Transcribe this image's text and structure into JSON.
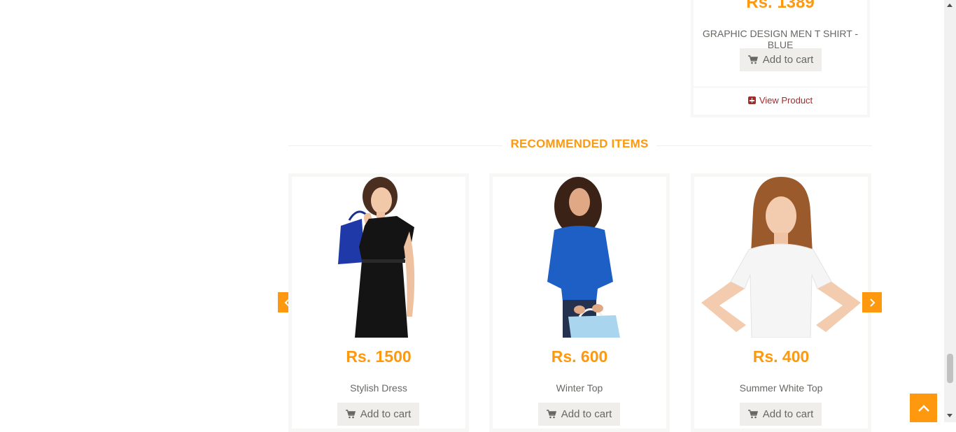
{
  "top_product": {
    "price": "Rs. 1389",
    "name": "GRAPHIC DESIGN MEN T SHIRT - BLUE",
    "add_to_cart": "Add to cart",
    "view_product": "View Product"
  },
  "recommended": {
    "title": "RECOMMENDED ITEMS",
    "items": [
      {
        "price": "Rs. 1500",
        "name": "Stylish Dress",
        "add_to_cart": "Add to cart"
      },
      {
        "price": "Rs. 600",
        "name": "Winter Top",
        "add_to_cart": "Add to cart"
      },
      {
        "price": "Rs. 400",
        "name": "Summer White Top",
        "add_to_cart": "Add to cart"
      }
    ]
  },
  "icons": {
    "cart": "shopping-cart-icon",
    "plus": "plus-square-icon",
    "prev": "chevron-left-icon",
    "next": "chevron-right-icon",
    "scroll_top": "chevron-up-icon"
  },
  "colors": {
    "accent": "#fe980f",
    "link": "#a52a2a",
    "button_bg": "#f0eeea",
    "text": "#696763"
  }
}
